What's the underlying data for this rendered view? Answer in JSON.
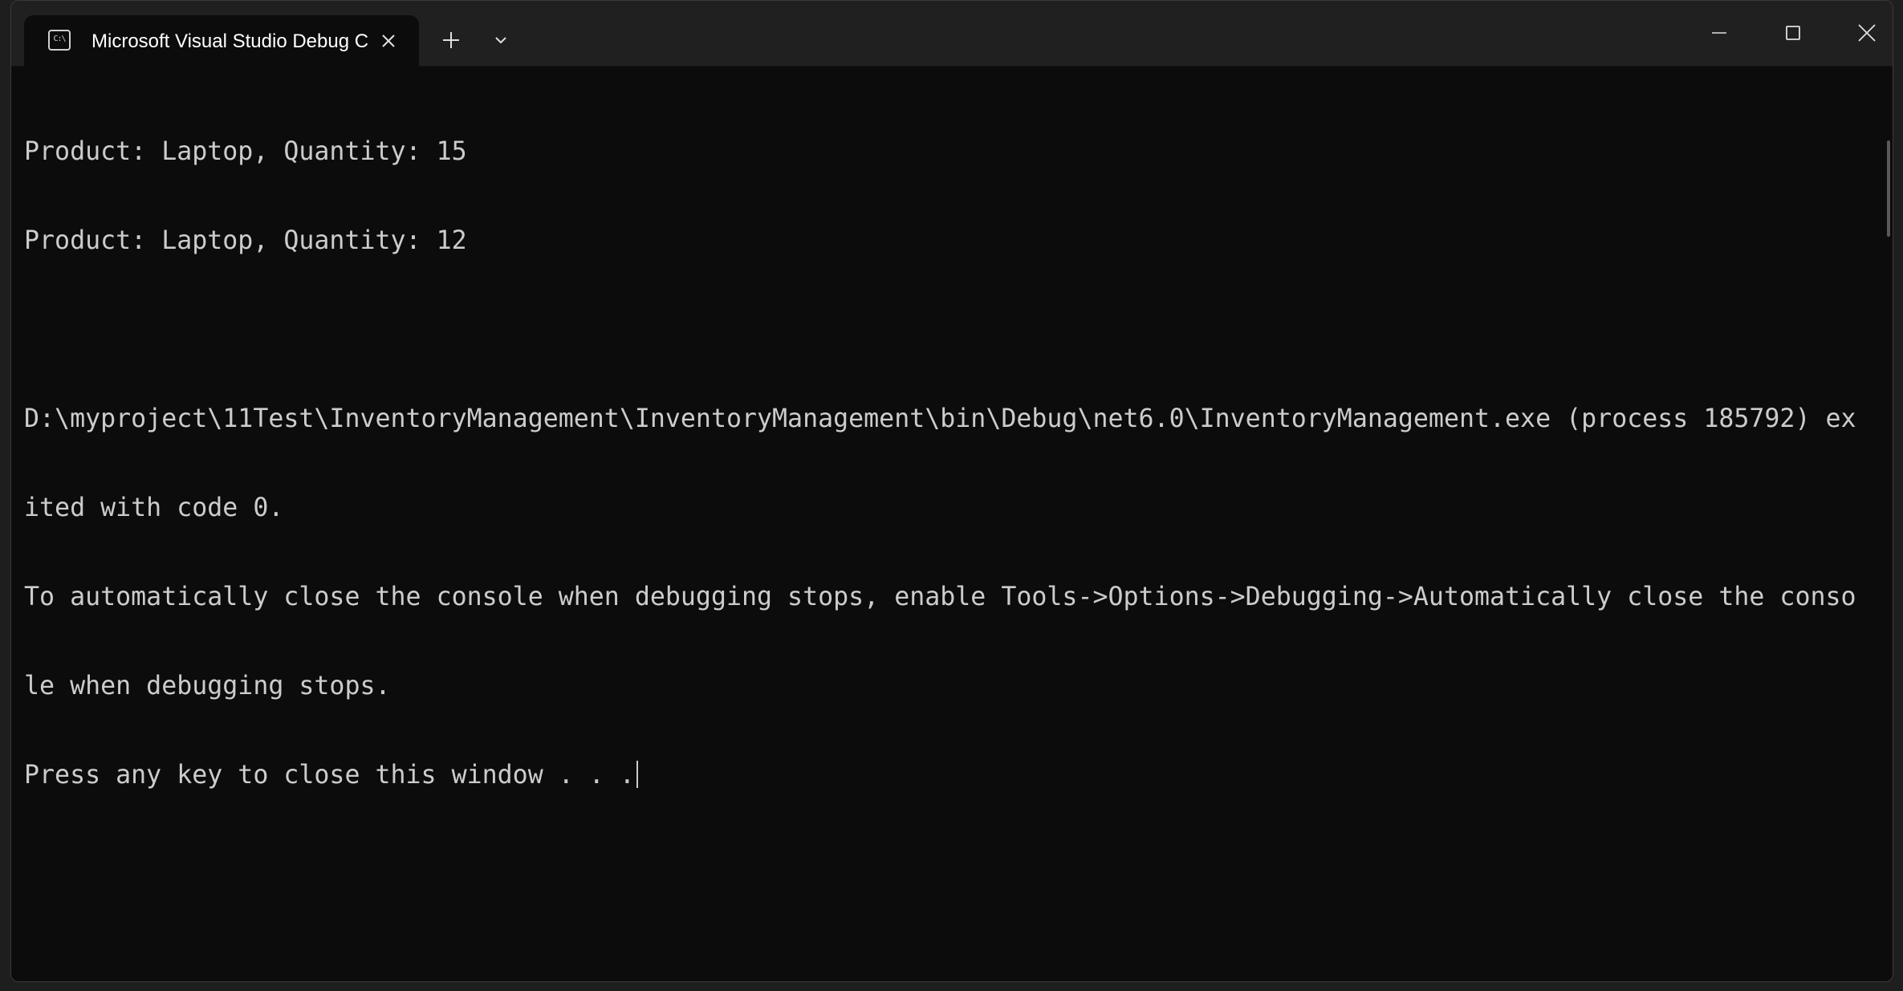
{
  "window": {
    "tab_title": "Microsoft Visual Studio Debug Console",
    "tab_icon": "console-icon",
    "icons": {
      "close_tab": "close-icon",
      "new_tab": "plus-icon",
      "dropdown": "chevron-down-icon",
      "minimize": "minimize-icon",
      "maximize": "maximize-icon",
      "close_window": "close-icon"
    }
  },
  "console": {
    "lines": [
      "Product: Laptop, Quantity: 15",
      "Product: Laptop, Quantity: 12",
      "",
      "D:\\myproject\\11Test\\InventoryManagement\\InventoryManagement\\bin\\Debug\\net6.0\\InventoryManagement.exe (process 185792) ex",
      "ited with code 0.",
      "To automatically close the console when debugging stops, enable Tools->Options->Debugging->Automatically close the conso",
      "le when debugging stops.",
      "Press any key to close this window . . ."
    ]
  },
  "colors": {
    "console_bg": "#0c0c0c",
    "console_text": "#cccccc",
    "titlebar_bg": "#202020"
  }
}
